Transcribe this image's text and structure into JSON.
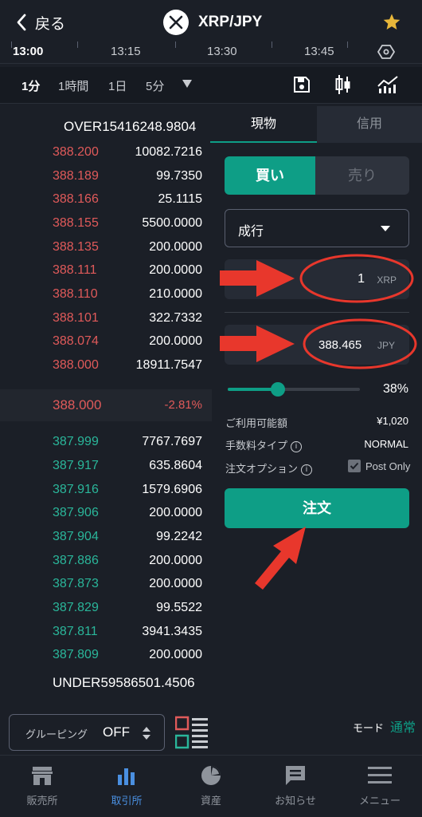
{
  "header": {
    "back_label": "戻る",
    "pair": "XRP/JPY"
  },
  "time_axis": [
    "13:00",
    "13:15",
    "13:30",
    "13:45"
  ],
  "toolbar": {
    "timeframes": [
      "1分",
      "1時間",
      "1日",
      "5分"
    ]
  },
  "order_book": {
    "over_label": "OVER",
    "over_value": "15416248.9804",
    "asks": [
      {
        "price": "388.200",
        "qty": "10082.7216"
      },
      {
        "price": "388.189",
        "qty": "99.7350"
      },
      {
        "price": "388.166",
        "qty": "25.1115"
      },
      {
        "price": "388.155",
        "qty": "5500.0000"
      },
      {
        "price": "388.135",
        "qty": "200.0000"
      },
      {
        "price": "388.111",
        "qty": "200.0000"
      },
      {
        "price": "388.110",
        "qty": "210.0000"
      },
      {
        "price": "388.101",
        "qty": "322.7332"
      },
      {
        "price": "388.074",
        "qty": "200.0000"
      },
      {
        "price": "388.000",
        "qty": "18911.7547"
      }
    ],
    "last_price": "388.000",
    "change": "-2.81%",
    "bids": [
      {
        "price": "387.999",
        "qty": "7767.7697"
      },
      {
        "price": "387.917",
        "qty": "635.8604"
      },
      {
        "price": "387.916",
        "qty": "1579.6906"
      },
      {
        "price": "387.906",
        "qty": "200.0000"
      },
      {
        "price": "387.904",
        "qty": "99.2242"
      },
      {
        "price": "387.886",
        "qty": "200.0000"
      },
      {
        "price": "387.873",
        "qty": "200.0000"
      },
      {
        "price": "387.829",
        "qty": "99.5522"
      },
      {
        "price": "387.811",
        "qty": "3941.3435"
      },
      {
        "price": "387.809",
        "qty": "200.0000"
      }
    ],
    "under_label": "UNDER",
    "under_value": "59586501.4506"
  },
  "grouping": {
    "label": "グルーピング",
    "value": "OFF"
  },
  "order_panel": {
    "tabs": [
      "現物",
      "信用"
    ],
    "buy_label": "買い",
    "sell_label": "売り",
    "order_type": "成行",
    "amount": "1",
    "amount_unit": "XRP",
    "price": "388.465",
    "price_unit": "JPY",
    "slider_percent": "38%",
    "slider_fraction": 0.38,
    "available_label": "ご利用可能額",
    "available_value": "¥1,020",
    "fee_label": "手数料タイプ",
    "fee_value": "NORMAL",
    "option_label": "注文オプション",
    "post_only_label": "Post Only",
    "post_only_checked": true,
    "submit_label": "注文"
  },
  "mode": {
    "label": "モード",
    "value": "通常"
  },
  "bottom_nav": [
    "販売所",
    "取引所",
    "資産",
    "お知らせ",
    "メニュー"
  ],
  "colors": {
    "accent": "#0e9e86",
    "ask": "#e05a5a",
    "bid": "#2ab69a",
    "annotation": "#e8372c"
  }
}
